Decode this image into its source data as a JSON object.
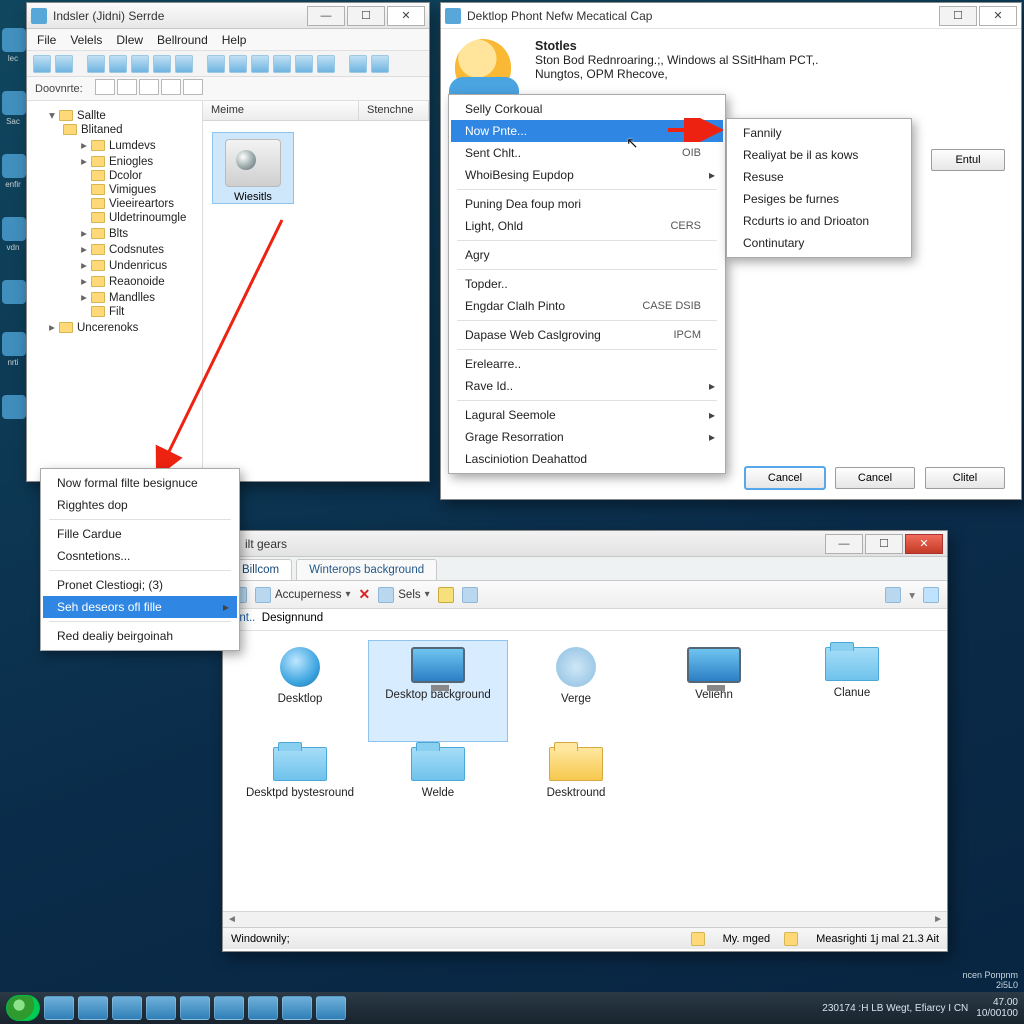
{
  "explorer": {
    "title": "Indsler (Jidni) Serrde",
    "menus": [
      "File",
      "Velels",
      "Dlew",
      "Bellround",
      "Help"
    ],
    "addr_label": "Doovnrte:",
    "tree_root": "Sallte",
    "tree_main": "Blitaned",
    "tree_items": [
      "Lumdevs",
      "Eniogles",
      "Dcolor",
      "Vimigues",
      "Vieeireartors",
      "Uldetrinoumgle",
      "Blts",
      "Codsnutes",
      "Undenricus",
      "Reaonoide",
      "Mandlles",
      "Filt"
    ],
    "tree_last": "Uncerenoks",
    "col1": "Meime",
    "col2": "Stenchne",
    "file_label": "Wiesitls"
  },
  "props": {
    "title": "Dektlop Phont Nefw Mecatical Cap",
    "heading": "Stotles",
    "line1": "Ston Bod Rednroaring.;, Windows al SSitHham PCT,.",
    "line2": "Nungtos, OPM Rhecove,",
    "side_btn": "Entul",
    "btn1": "Cancel",
    "btn2": "Cancel",
    "btn3": "Clitel"
  },
  "ctx_main": {
    "items": [
      {
        "label": "Selly Corkoual"
      },
      {
        "label": "Now Pnte...",
        "arrow": true,
        "hl": true
      },
      {
        "label": "Sent Chlt..",
        "sc": "OIB"
      },
      {
        "label": "WhoiBesing Eupdop",
        "arrow": true
      },
      {
        "sep": true
      },
      {
        "label": "Puning Dea foup mori"
      },
      {
        "label": "Light, Ohld",
        "sc": "CERS"
      },
      {
        "sep": true
      },
      {
        "label": "Agry"
      },
      {
        "sep": true
      },
      {
        "label": "Topder.."
      },
      {
        "label": "Engdar Clalh Pinto",
        "sc": "CASE DSIB"
      },
      {
        "sep": true
      },
      {
        "label": "Dapase Web Caslgroving",
        "sc": "IPCM"
      },
      {
        "sep": true
      },
      {
        "label": "Erelearre.."
      },
      {
        "label": "Rave Id..",
        "arrow": true
      },
      {
        "sep": true
      },
      {
        "label": "Lagural Seemole",
        "arrow": true
      },
      {
        "label": "Grage Resorration",
        "arrow": true
      },
      {
        "label": "Lasciniotion Deahattod"
      }
    ]
  },
  "ctx_sub": {
    "items": [
      "Fannily",
      "Realiyat be il as kows",
      "Resuse",
      "Pesiges be furnes",
      "Rcdurts io and Drioaton",
      "Continutary"
    ]
  },
  "ctx_small": {
    "items": [
      {
        "label": "Now formal filte besignuce"
      },
      {
        "label": "Rigghtes dop"
      },
      {
        "sep": true
      },
      {
        "label": "Fille Cardue"
      },
      {
        "label": "Cosntetions..."
      },
      {
        "sep": true
      },
      {
        "label": "Pronet Clestiogi; (3)"
      },
      {
        "label": "Seh deseors ofl fille",
        "hl": true,
        "arrow": true
      },
      {
        "sep": true
      },
      {
        "label": "Red dealiy beirgoinah"
      }
    ]
  },
  "bottom": {
    "title": "ilt gears",
    "tab1": "Billcom",
    "tab2": "Winterops background",
    "tool_item1": "Accuperness",
    "tool_item2": "Sels",
    "crumb1": "ent..",
    "crumb2": "Designnund",
    "icons": [
      {
        "label": "Desktlop",
        "type": "globe"
      },
      {
        "label": "Desktop background",
        "type": "monitor",
        "sel": true
      },
      {
        "label": "Verge",
        "type": "gear"
      },
      {
        "label": "Veliehn",
        "type": "monitor"
      },
      {
        "label": "Clanue",
        "type": "folder"
      },
      {
        "label": "Desktpd bystesround",
        "type": "folder"
      },
      {
        "label": "Welde",
        "type": "folder"
      },
      {
        "label": "Desktround",
        "type": "yfolder"
      }
    ],
    "status_left": "Windownily;",
    "status_mid": "My. mged",
    "status_right": "Measrighti 1j  mal 21.3   Ait"
  },
  "tray": {
    "line1": "230174   :H LB Wegt,  Efiarcy I CN",
    "line2": "47.00",
    "line3": "10/00100"
  },
  "footnote": "ncen Ponpnm\n2i5L0"
}
